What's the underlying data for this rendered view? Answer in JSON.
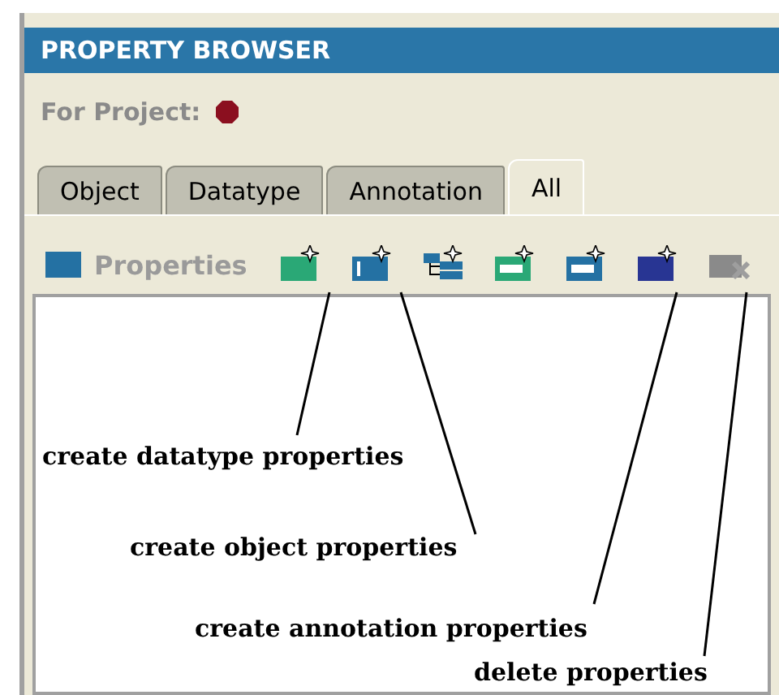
{
  "panel": {
    "title": "PROPERTY BROWSER",
    "project_label": "For Project:"
  },
  "tabs": [
    {
      "label": "Object",
      "selected": false
    },
    {
      "label": "Datatype",
      "selected": false
    },
    {
      "label": "Annotation",
      "selected": false
    },
    {
      "label": "All",
      "selected": true
    }
  ],
  "properties": {
    "label": "Properties"
  },
  "tools": [
    {
      "kind": "datatype"
    },
    {
      "kind": "object"
    },
    {
      "kind": "subproperty"
    },
    {
      "kind": "datatype-sub"
    },
    {
      "kind": "object-sub"
    },
    {
      "kind": "annotation"
    },
    {
      "kind": "delete"
    }
  ],
  "annotations": [
    {
      "text": "create datatype properties"
    },
    {
      "text": "create object properties"
    },
    {
      "text": "create annotation properties"
    },
    {
      "text": "delete properties"
    }
  ]
}
